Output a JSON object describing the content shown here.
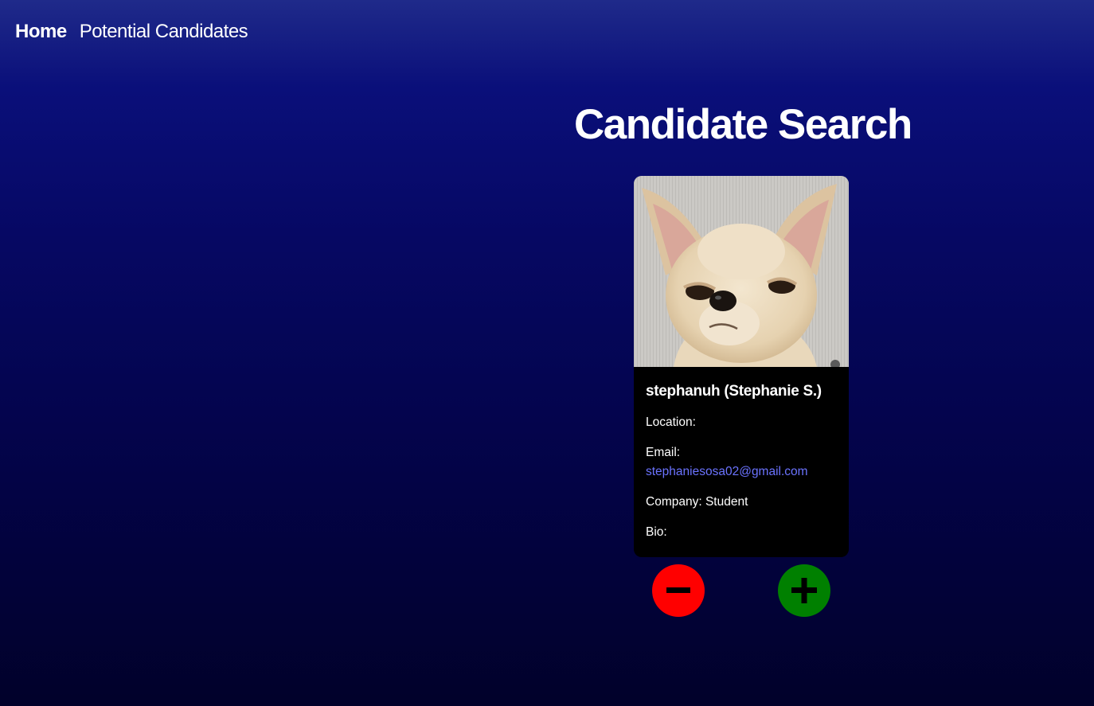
{
  "nav": {
    "home_label": "Home",
    "potential_candidates_label": "Potential Candidates"
  },
  "page": {
    "title": "Candidate Search"
  },
  "candidate": {
    "avatar_icon": "chihuahua-avatar",
    "username": "stephanuh (Stephanie S.)",
    "location_label": "Location:",
    "email_label": "Email:",
    "email": "stephaniesosa02@gmail.com",
    "company_label": "Company: Student",
    "bio_label": "Bio:"
  },
  "actions": {
    "reject_icon": "minus-icon",
    "accept_icon": "plus-icon",
    "reject_color": "#ff0000",
    "accept_color": "#008000"
  }
}
